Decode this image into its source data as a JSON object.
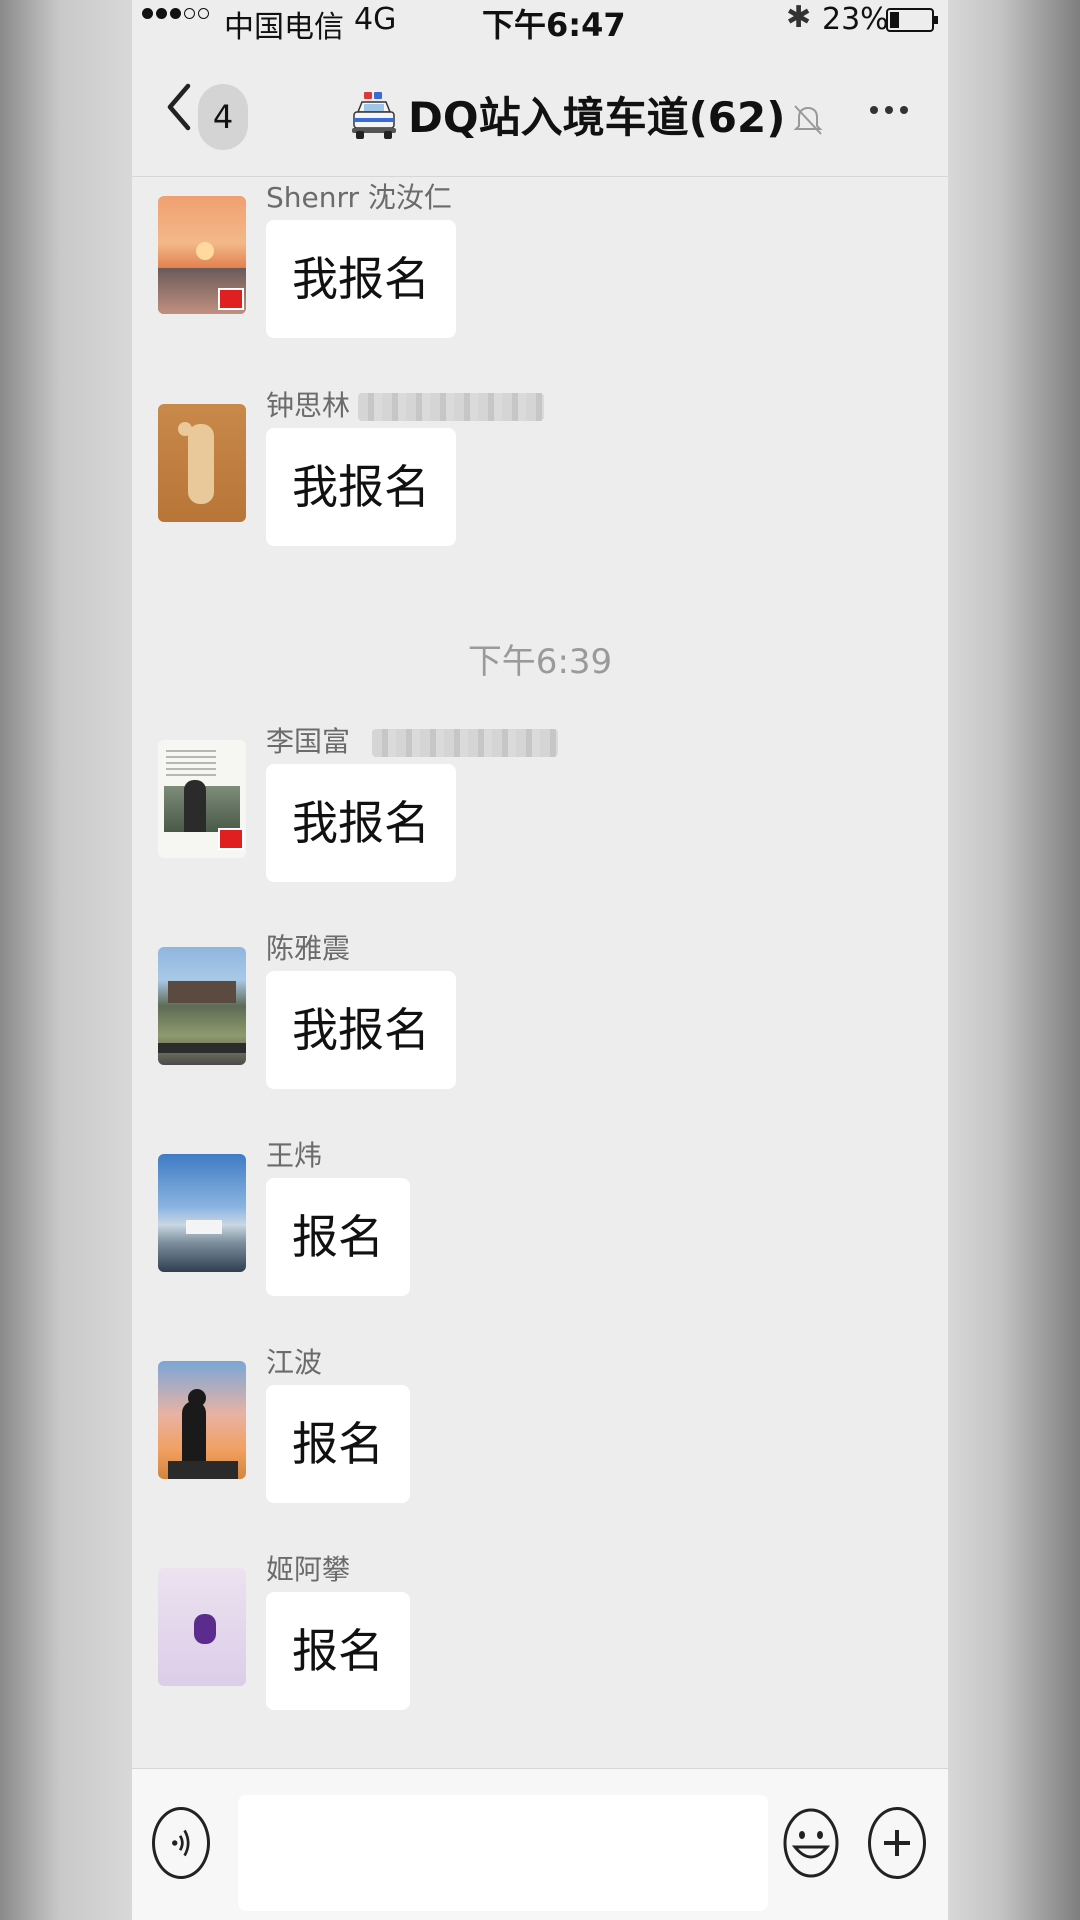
{
  "status_bar": {
    "carrier": "中国电信",
    "network": "4G",
    "time": "下午6:47",
    "battery_percent": "23%",
    "battery_level": 0.23
  },
  "nav": {
    "unread_count": "4",
    "title": "DQ站入境车道(62)"
  },
  "messages_before": [
    {
      "sender": "Shenrr 沈汝仁",
      "text": "我报名"
    },
    {
      "sender": "钟思林",
      "text": "我报名"
    }
  ],
  "timestamp": "下午6:39",
  "messages_after": [
    {
      "sender": "李国富",
      "text": "我报名"
    },
    {
      "sender": "陈雅震",
      "text": "我报名"
    },
    {
      "sender": "王炜",
      "text": "报名"
    },
    {
      "sender": "江波",
      "text": "报名"
    },
    {
      "sender": "姬阿攀",
      "text": "报名"
    }
  ],
  "icons": {
    "back": "chevron-left-icon",
    "car": "police-car-icon",
    "mute": "bell-off-icon",
    "more": "more-icon",
    "voice": "voice-icon",
    "emoji": "emoji-icon",
    "plus": "plus-icon"
  },
  "colors": {
    "chat_background": "#ededed",
    "bubble": "#ffffff",
    "sender_text": "#6b6b6b"
  }
}
